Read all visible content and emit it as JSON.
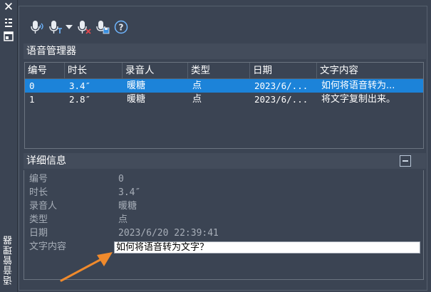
{
  "sidebar": {
    "title": "语音管理器"
  },
  "toolbar": {
    "icons": [
      "mic-play-icon",
      "mic-text-icon",
      "dropdown-arrow-icon",
      "mic-delete-icon",
      "mic-save-icon",
      "help-icon"
    ]
  },
  "manager": {
    "title": "语音管理器",
    "columns": [
      "编号",
      "时长",
      "录音人",
      "类型",
      "日期",
      "文字内容"
    ],
    "rows": [
      {
        "id": "0",
        "duration": "3.4″",
        "recorder": "暖糖",
        "type": "点",
        "date": "2023/6/...",
        "text": "如何将语音转为...",
        "selected": true
      },
      {
        "id": "1",
        "duration": "2.8″",
        "recorder": "暖糖",
        "type": "点",
        "date": "2023/6/...",
        "text": "将文字复制出来。",
        "selected": false
      }
    ]
  },
  "details": {
    "title": "详细信息",
    "fields": [
      {
        "label": "编号",
        "value": "0"
      },
      {
        "label": "时长",
        "value": "3.4″"
      },
      {
        "label": "录音人",
        "value": "暖糖"
      },
      {
        "label": "类型",
        "value": "点"
      },
      {
        "label": "日期",
        "value": "2023/6/20 22:39:41"
      }
    ],
    "text_label": "文字内容",
    "text_value": "如何将语音转为文字？"
  },
  "colors": {
    "background": "#3b4453",
    "selection": "#1c83d9",
    "annotation_arrow": "#f08a2c"
  }
}
